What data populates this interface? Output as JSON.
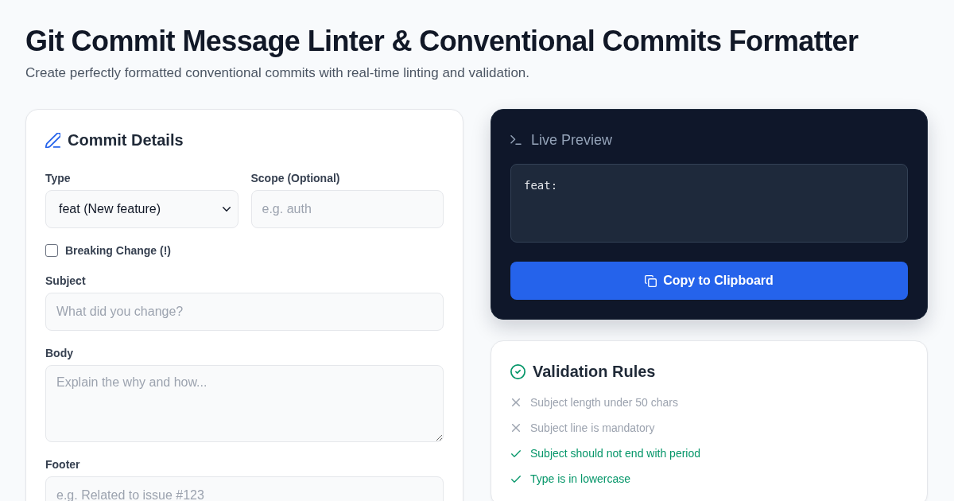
{
  "header": {
    "title": "Git Commit Message Linter & Conventional Commits Formatter",
    "subtitle": "Create perfectly formatted conventional commits with real-time linting and validation."
  },
  "commit_details": {
    "title": "Commit Details",
    "rows": [
      [
        {
          "kind": "select",
          "label": "Type",
          "value": "feat (New feature)"
        },
        {
          "kind": "input",
          "label": "Scope (Optional)",
          "placeholder": "e.g. auth"
        }
      ],
      [
        {
          "kind": "checkbox",
          "label": "Breaking Change (!)",
          "checked": false
        }
      ],
      [
        {
          "kind": "input",
          "label": "Subject",
          "placeholder": "What did you change?"
        }
      ],
      [
        {
          "kind": "textarea",
          "label": "Body",
          "placeholder": "Explain the why and how..."
        }
      ],
      [
        {
          "kind": "input",
          "label": "Footer",
          "placeholder": "e.g. Related to issue #123"
        }
      ]
    ]
  },
  "live_preview": {
    "title": "Live Preview",
    "output": "feat:",
    "copy_button": "Copy to Clipboard"
  },
  "validation": {
    "title": "Validation Rules",
    "rules": [
      {
        "text": "Subject length under 50 chars",
        "passed": false
      },
      {
        "text": "Subject line is mandatory",
        "passed": false
      },
      {
        "text": "Subject should not end with period",
        "passed": true
      },
      {
        "text": "Type is in lowercase",
        "passed": true
      }
    ]
  }
}
